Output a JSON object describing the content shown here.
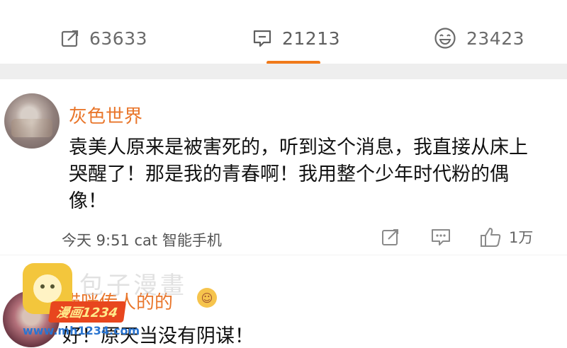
{
  "stats": {
    "repost_count": "63633",
    "comment_count": "21213",
    "like_count": "23423",
    "active_color": "#f07a1a"
  },
  "comments": [
    {
      "username": "灰色世界",
      "text": "袁美人原来是被害死的，听到这个消息，我直接从床上哭醒了！那是我的青春啊！我用整个少年时代粉的偶像！",
      "meta": "今天 9:51 cat 智能手机",
      "likes": "1万"
    },
    {
      "username": "喵咪传人的的",
      "text": "好！原天当没有阴谋！"
    }
  ],
  "watermark": {
    "site_cn": "包子漫畫",
    "badge": "漫画1234",
    "url": "www.mh1234.com"
  },
  "colors": {
    "username": "#e9762b",
    "watermark_badge": "#e8461e"
  }
}
